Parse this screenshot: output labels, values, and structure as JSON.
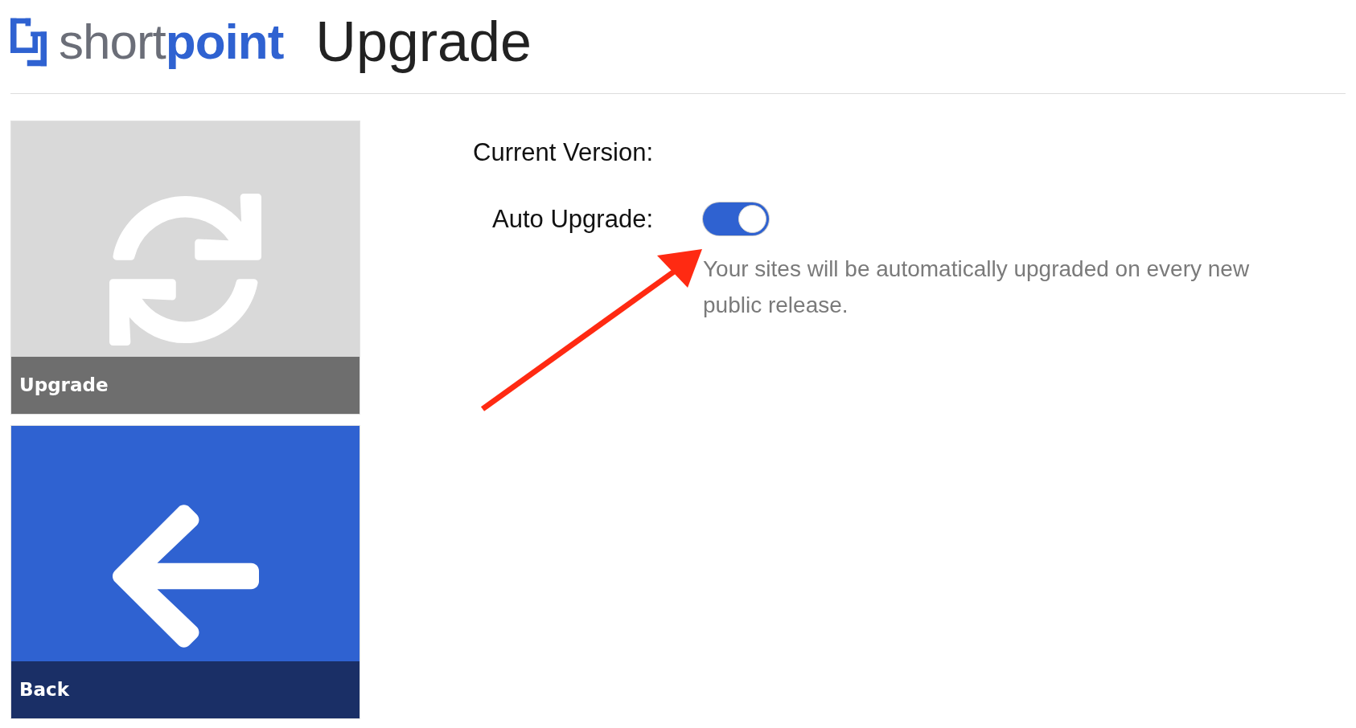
{
  "header": {
    "logo": "short**point**",
    "title": "Upgrade"
  },
  "tiles": [
    {
      "kind": "refresh",
      "label": "Upgrade"
    },
    {
      "kind": "back",
      "label": "Back"
    }
  ],
  "settings": [
    {
      "kind": "text",
      "label": "Current Version:"
    },
    {
      "kind": "toggle",
      "label": "Auto Upgrade:",
      "on": true,
      "help": "Your sites will be automatically upgraded on every new public release."
    }
  ]
}
